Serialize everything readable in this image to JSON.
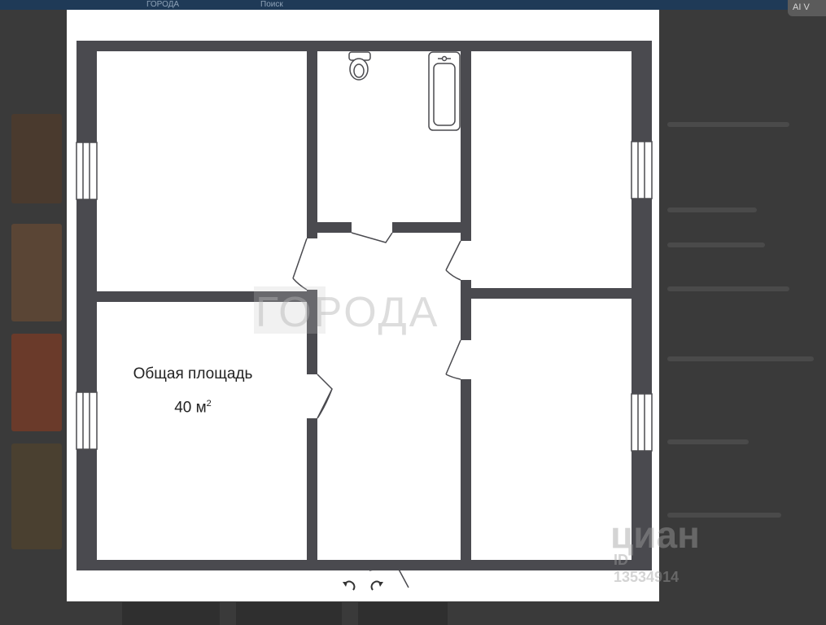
{
  "background": {
    "tabs": [
      "ГОРОДА",
      "Поиск"
    ],
    "ai_button_label": "AI V"
  },
  "floor_plan": {
    "area_label": "Общая площадь",
    "area_value": "40 м",
    "area_unit_sup": "2",
    "watermark_text": "ГОРОДА",
    "source_logo": "циан",
    "source_id": "ID 13534914"
  },
  "controls": {
    "rotate_left_icon": "rotate-left-icon",
    "rotate_right_icon": "rotate-right-icon"
  },
  "colors": {
    "wall": "#4a4a4f",
    "modal_bg": "#ffffff",
    "overlay": "#2b2b2b"
  }
}
